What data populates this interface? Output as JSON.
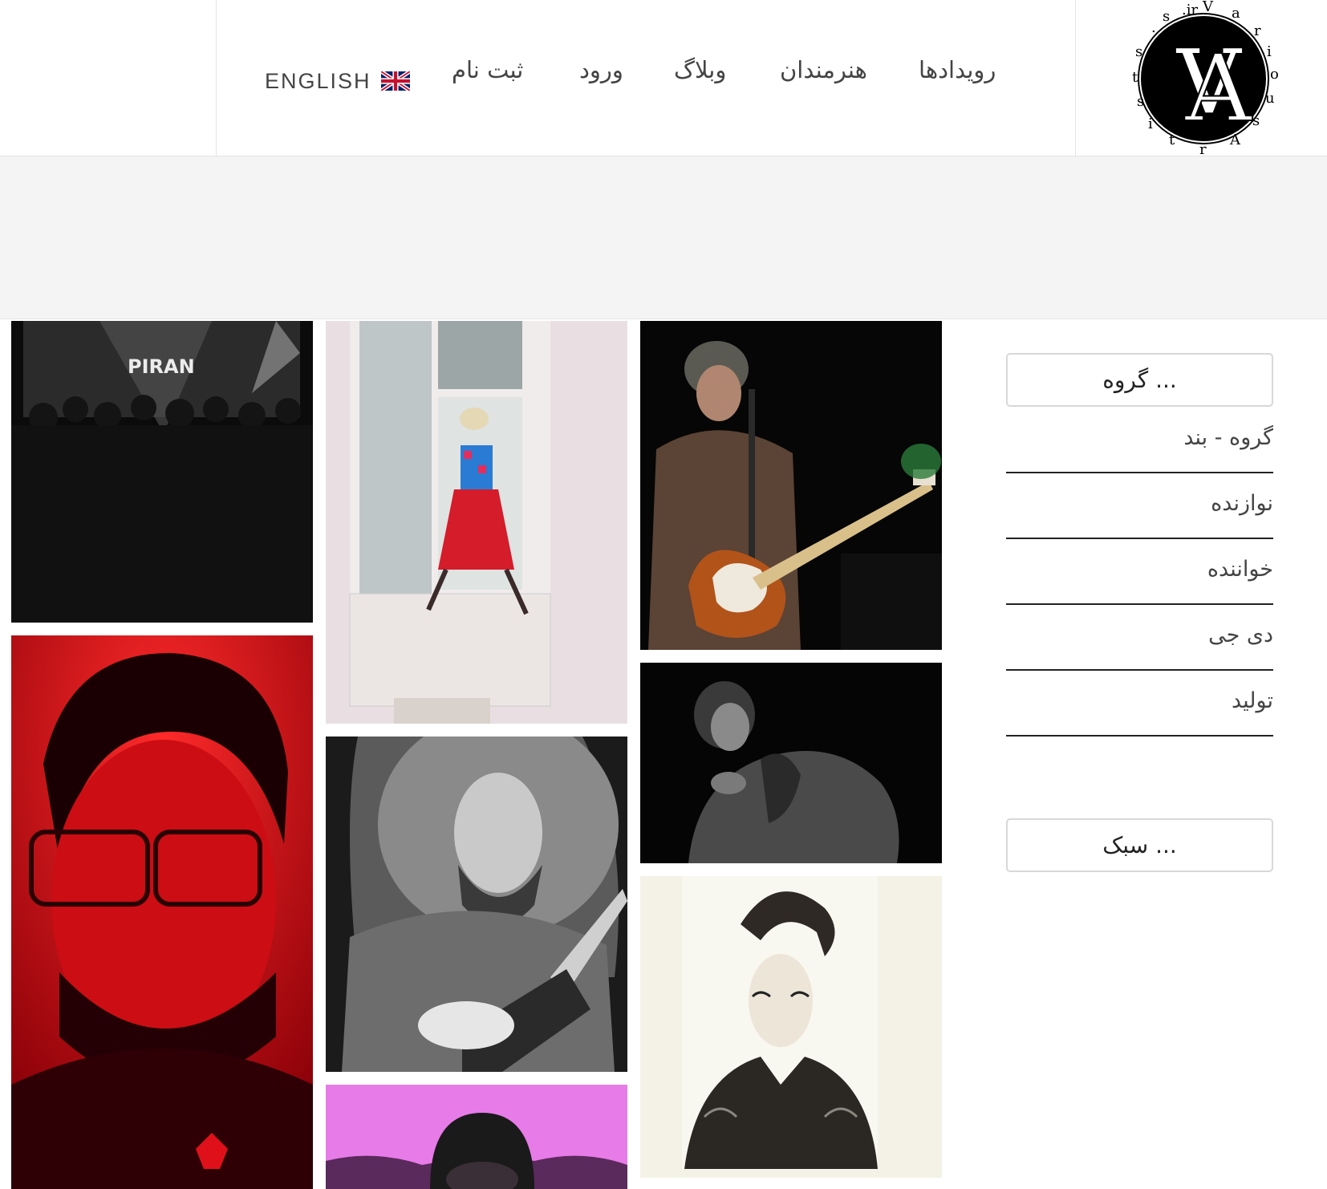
{
  "header": {
    "logo_alt": "Various Artists",
    "nav": [
      {
        "label": "رویدادها"
      },
      {
        "label": "هنرمندان"
      },
      {
        "label": "وبلاگ"
      },
      {
        "label": "ورود"
      },
      {
        "label": "ثبت نام"
      },
      {
        "label": "ENGLISH"
      }
    ]
  },
  "gallery": {
    "tiles": [
      {
        "name": "piran-concert",
        "sign_text": "PIRAN"
      },
      {
        "name": "woman-in-doorway"
      },
      {
        "name": "guitarist-singer"
      },
      {
        "name": "red-portrait"
      },
      {
        "name": "curly-guitarist"
      },
      {
        "name": "man-in-jacket"
      },
      {
        "name": "pink-beanie"
      },
      {
        "name": "woman-portrait"
      }
    ]
  },
  "sidebar": {
    "group_dropdown": "گروه ...",
    "categories": [
      {
        "label": "گروه - بند"
      },
      {
        "label": "نوازنده"
      },
      {
        "label": "خواننده"
      },
      {
        "label": "دی جی"
      },
      {
        "label": "تولید"
      }
    ],
    "style_dropdown": "سبک ..."
  },
  "colors": {
    "banner_bg": "#f4f4f4",
    "divider": "#e4e4e4",
    "red_tile": "#e0101a",
    "pink_tile": "#e77be8"
  }
}
